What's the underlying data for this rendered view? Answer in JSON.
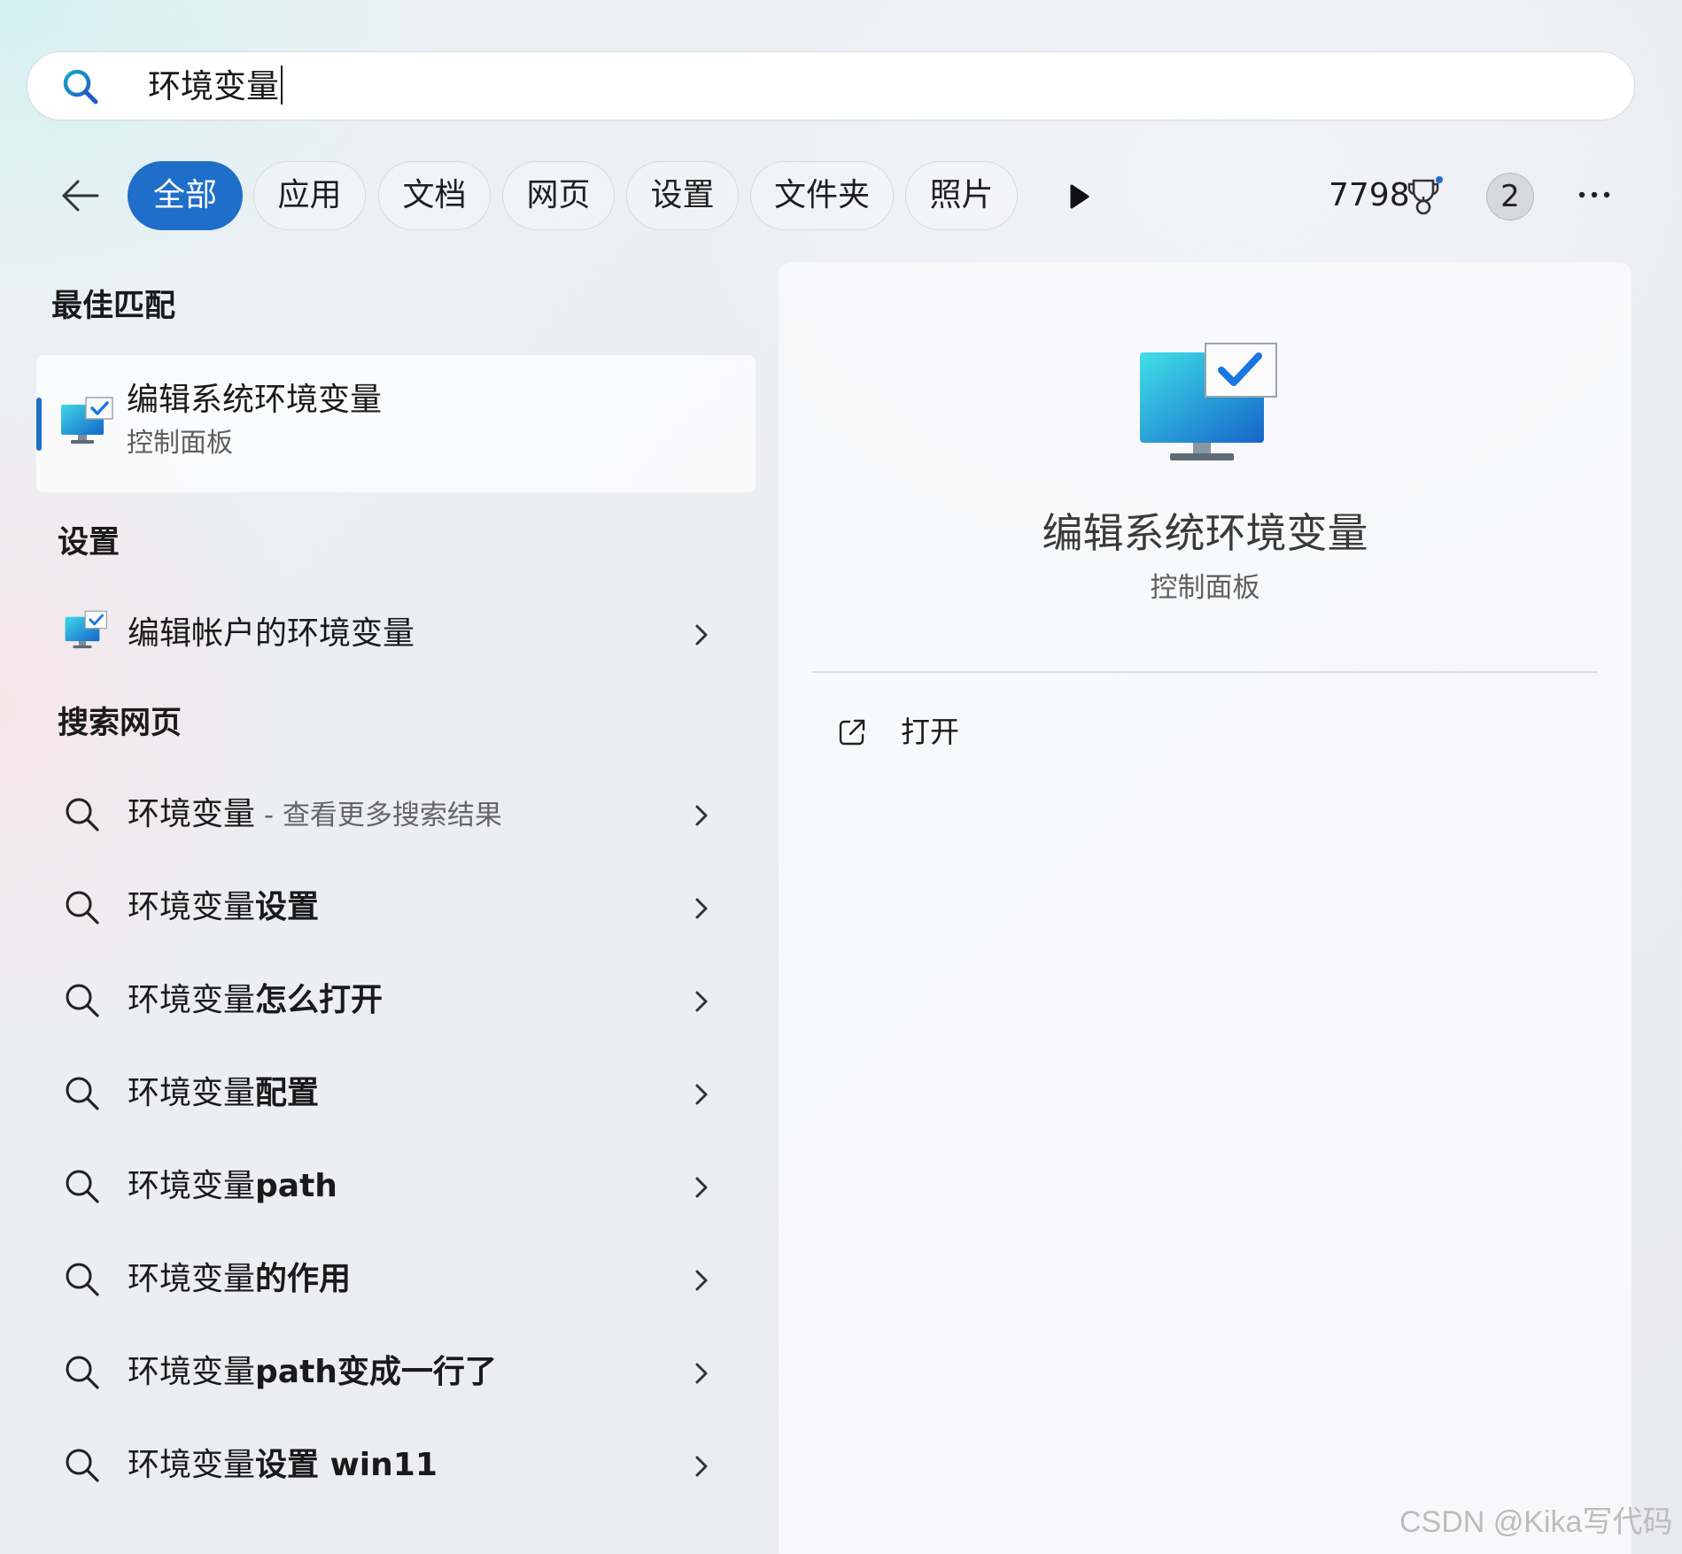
{
  "search": {
    "query": "环境变量"
  },
  "filters": {
    "tabs": [
      {
        "label": "全部",
        "active": true
      },
      {
        "label": "应用",
        "active": false
      },
      {
        "label": "文档",
        "active": false
      },
      {
        "label": "网页",
        "active": false
      },
      {
        "label": "设置",
        "active": false
      },
      {
        "label": "文件夹",
        "active": false
      },
      {
        "label": "照片",
        "active": false
      }
    ],
    "points": "7798",
    "avatar_initial": "2"
  },
  "best_match": {
    "heading": "最佳匹配",
    "title": "编辑系统环境变量",
    "subtitle": "控制面板"
  },
  "settings": {
    "heading": "设置",
    "items": [
      {
        "label": "编辑帐户的环境变量"
      }
    ]
  },
  "web": {
    "heading": "搜索网页",
    "items": [
      {
        "prefix": "环境变量",
        "hint": " - 查看更多搜索结果",
        "suffix": ""
      },
      {
        "prefix": "环境变量",
        "hint": "",
        "suffix": "设置"
      },
      {
        "prefix": "环境变量",
        "hint": "",
        "suffix": "怎么打开"
      },
      {
        "prefix": "环境变量",
        "hint": "",
        "suffix": "配置"
      },
      {
        "prefix": "环境变量",
        "hint": "",
        "suffix": "path"
      },
      {
        "prefix": "环境变量",
        "hint": "",
        "suffix": "的作用"
      },
      {
        "prefix": "环境变量",
        "hint": "",
        "suffix": "path变成一行了"
      },
      {
        "prefix": "环境变量",
        "hint": "",
        "suffix": "设置 win11"
      }
    ]
  },
  "detail": {
    "title": "编辑系统环境变量",
    "subtitle": "控制面板",
    "actions": [
      {
        "label": "打开",
        "icon": "open-external-icon"
      }
    ]
  },
  "watermark": "CSDN @Kika写代码",
  "colors": {
    "accent": "#1f6ec9"
  }
}
